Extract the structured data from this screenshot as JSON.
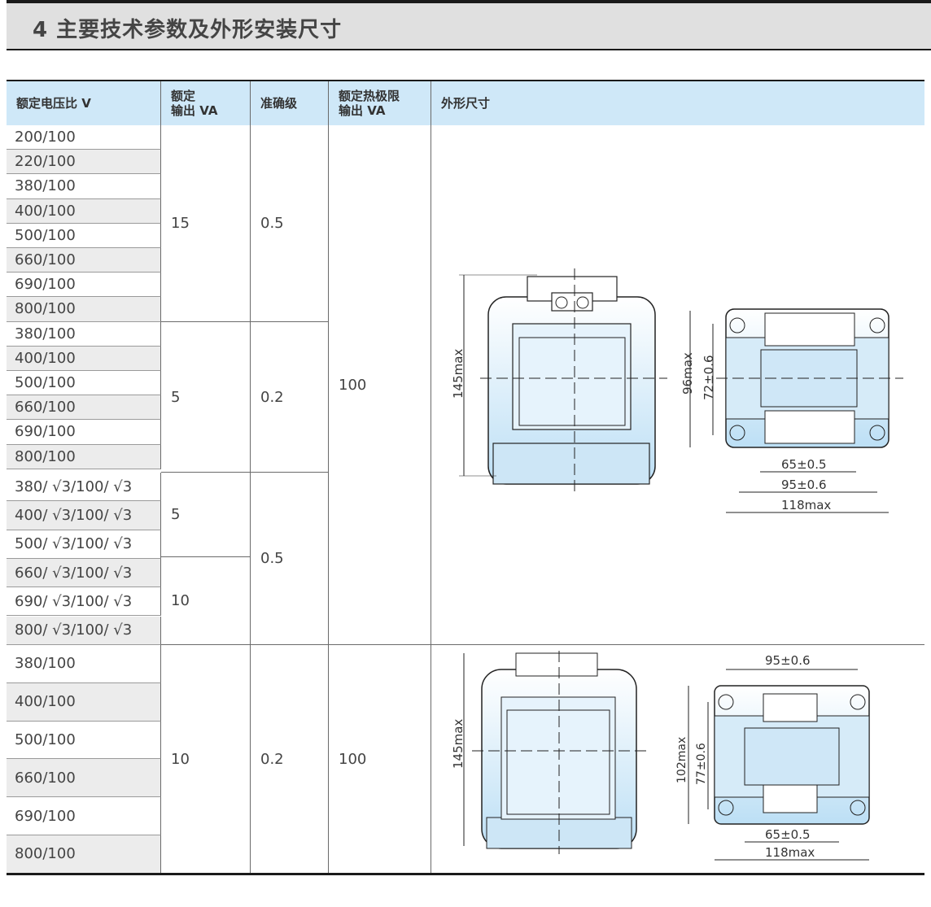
{
  "title": "4 主要技术参数及外形安装尺寸",
  "headers": {
    "ratio": "额定电压比 V",
    "output": "额定\n输出 VA",
    "accuracy": "准确级",
    "thermal": "额定热极限\n输出 VA",
    "dimensions": "外形尺寸"
  },
  "rows": [
    "200/100",
    "220/100",
    "380/100",
    "400/100",
    "500/100",
    "660/100",
    "690/100",
    "800/100",
    "380/100",
    "400/100",
    "500/100",
    "660/100",
    "690/100",
    "800/100",
    "380/ √3/100/ √3",
    "400/ √3/100/ √3",
    "500/ √3/100/ √3",
    "660/ √3/100/ √3",
    "690/ √3/100/ √3",
    "800/ √3/100/ √3",
    "380/100",
    "400/100",
    "500/100",
    "660/100",
    "690/100",
    "800/100"
  ],
  "groups": {
    "g1_output": "15",
    "g1_accuracy": "0.5",
    "g2_output": "5",
    "g2_accuracy": "0.2",
    "g3a_output": "5",
    "g3b_output": "10",
    "g3_accuracy": "0.5",
    "top_thermal": "100",
    "g4_output": "10",
    "g4_accuracy": "0.2",
    "g4_thermal": "100"
  },
  "drawing1": {
    "height": "145max",
    "side_h1": "96max",
    "side_h2": "72±0.6",
    "w1": "65±0.5",
    "w2": "95±0.6",
    "w3": "118max"
  },
  "drawing2": {
    "height": "145max",
    "top_w": "95±0.6",
    "side_h1": "102max",
    "side_h2": "77±0.6",
    "w1": "65±0.5",
    "w2": "118max"
  }
}
